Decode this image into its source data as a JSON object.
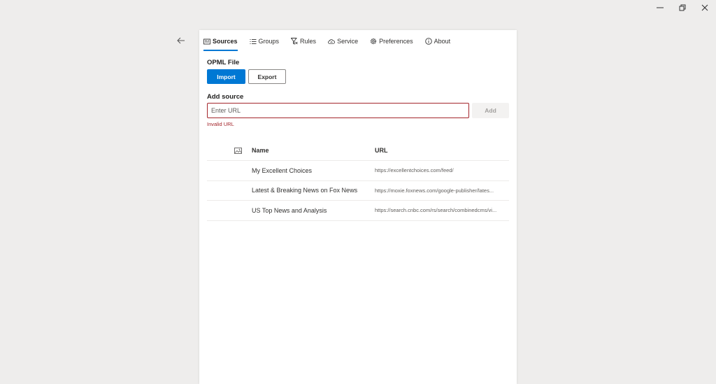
{
  "tabs": [
    {
      "label": "Sources",
      "icon": "sources-icon",
      "active": true
    },
    {
      "label": "Groups",
      "icon": "groups-icon",
      "active": false
    },
    {
      "label": "Rules",
      "icon": "rules-icon",
      "active": false
    },
    {
      "label": "Service",
      "icon": "service-icon",
      "active": false
    },
    {
      "label": "Preferences",
      "icon": "preferences-icon",
      "active": false
    },
    {
      "label": "About",
      "icon": "about-icon",
      "active": false
    }
  ],
  "opml": {
    "title": "OPML File",
    "import_label": "Import",
    "export_label": "Export"
  },
  "add_source": {
    "title": "Add source",
    "placeholder": "Enter URL",
    "value": "",
    "error": "Invalid URL",
    "add_label": "Add"
  },
  "table": {
    "headers": {
      "name": "Name",
      "url": "URL"
    },
    "rows": [
      {
        "name": "My Excellent Choices",
        "url": "https://excellentchoices.com/feed/"
      },
      {
        "name": "Latest & Breaking News on Fox News",
        "url": "https://moxie.foxnews.com/google-publisher/lates..."
      },
      {
        "name": "US Top News and Analysis",
        "url": "https://search.cnbc.com/rs/search/combinedcms/vi..."
      }
    ]
  },
  "colors": {
    "accent": "#0078d4",
    "error": "#a4262c",
    "background": "#eeedec"
  }
}
